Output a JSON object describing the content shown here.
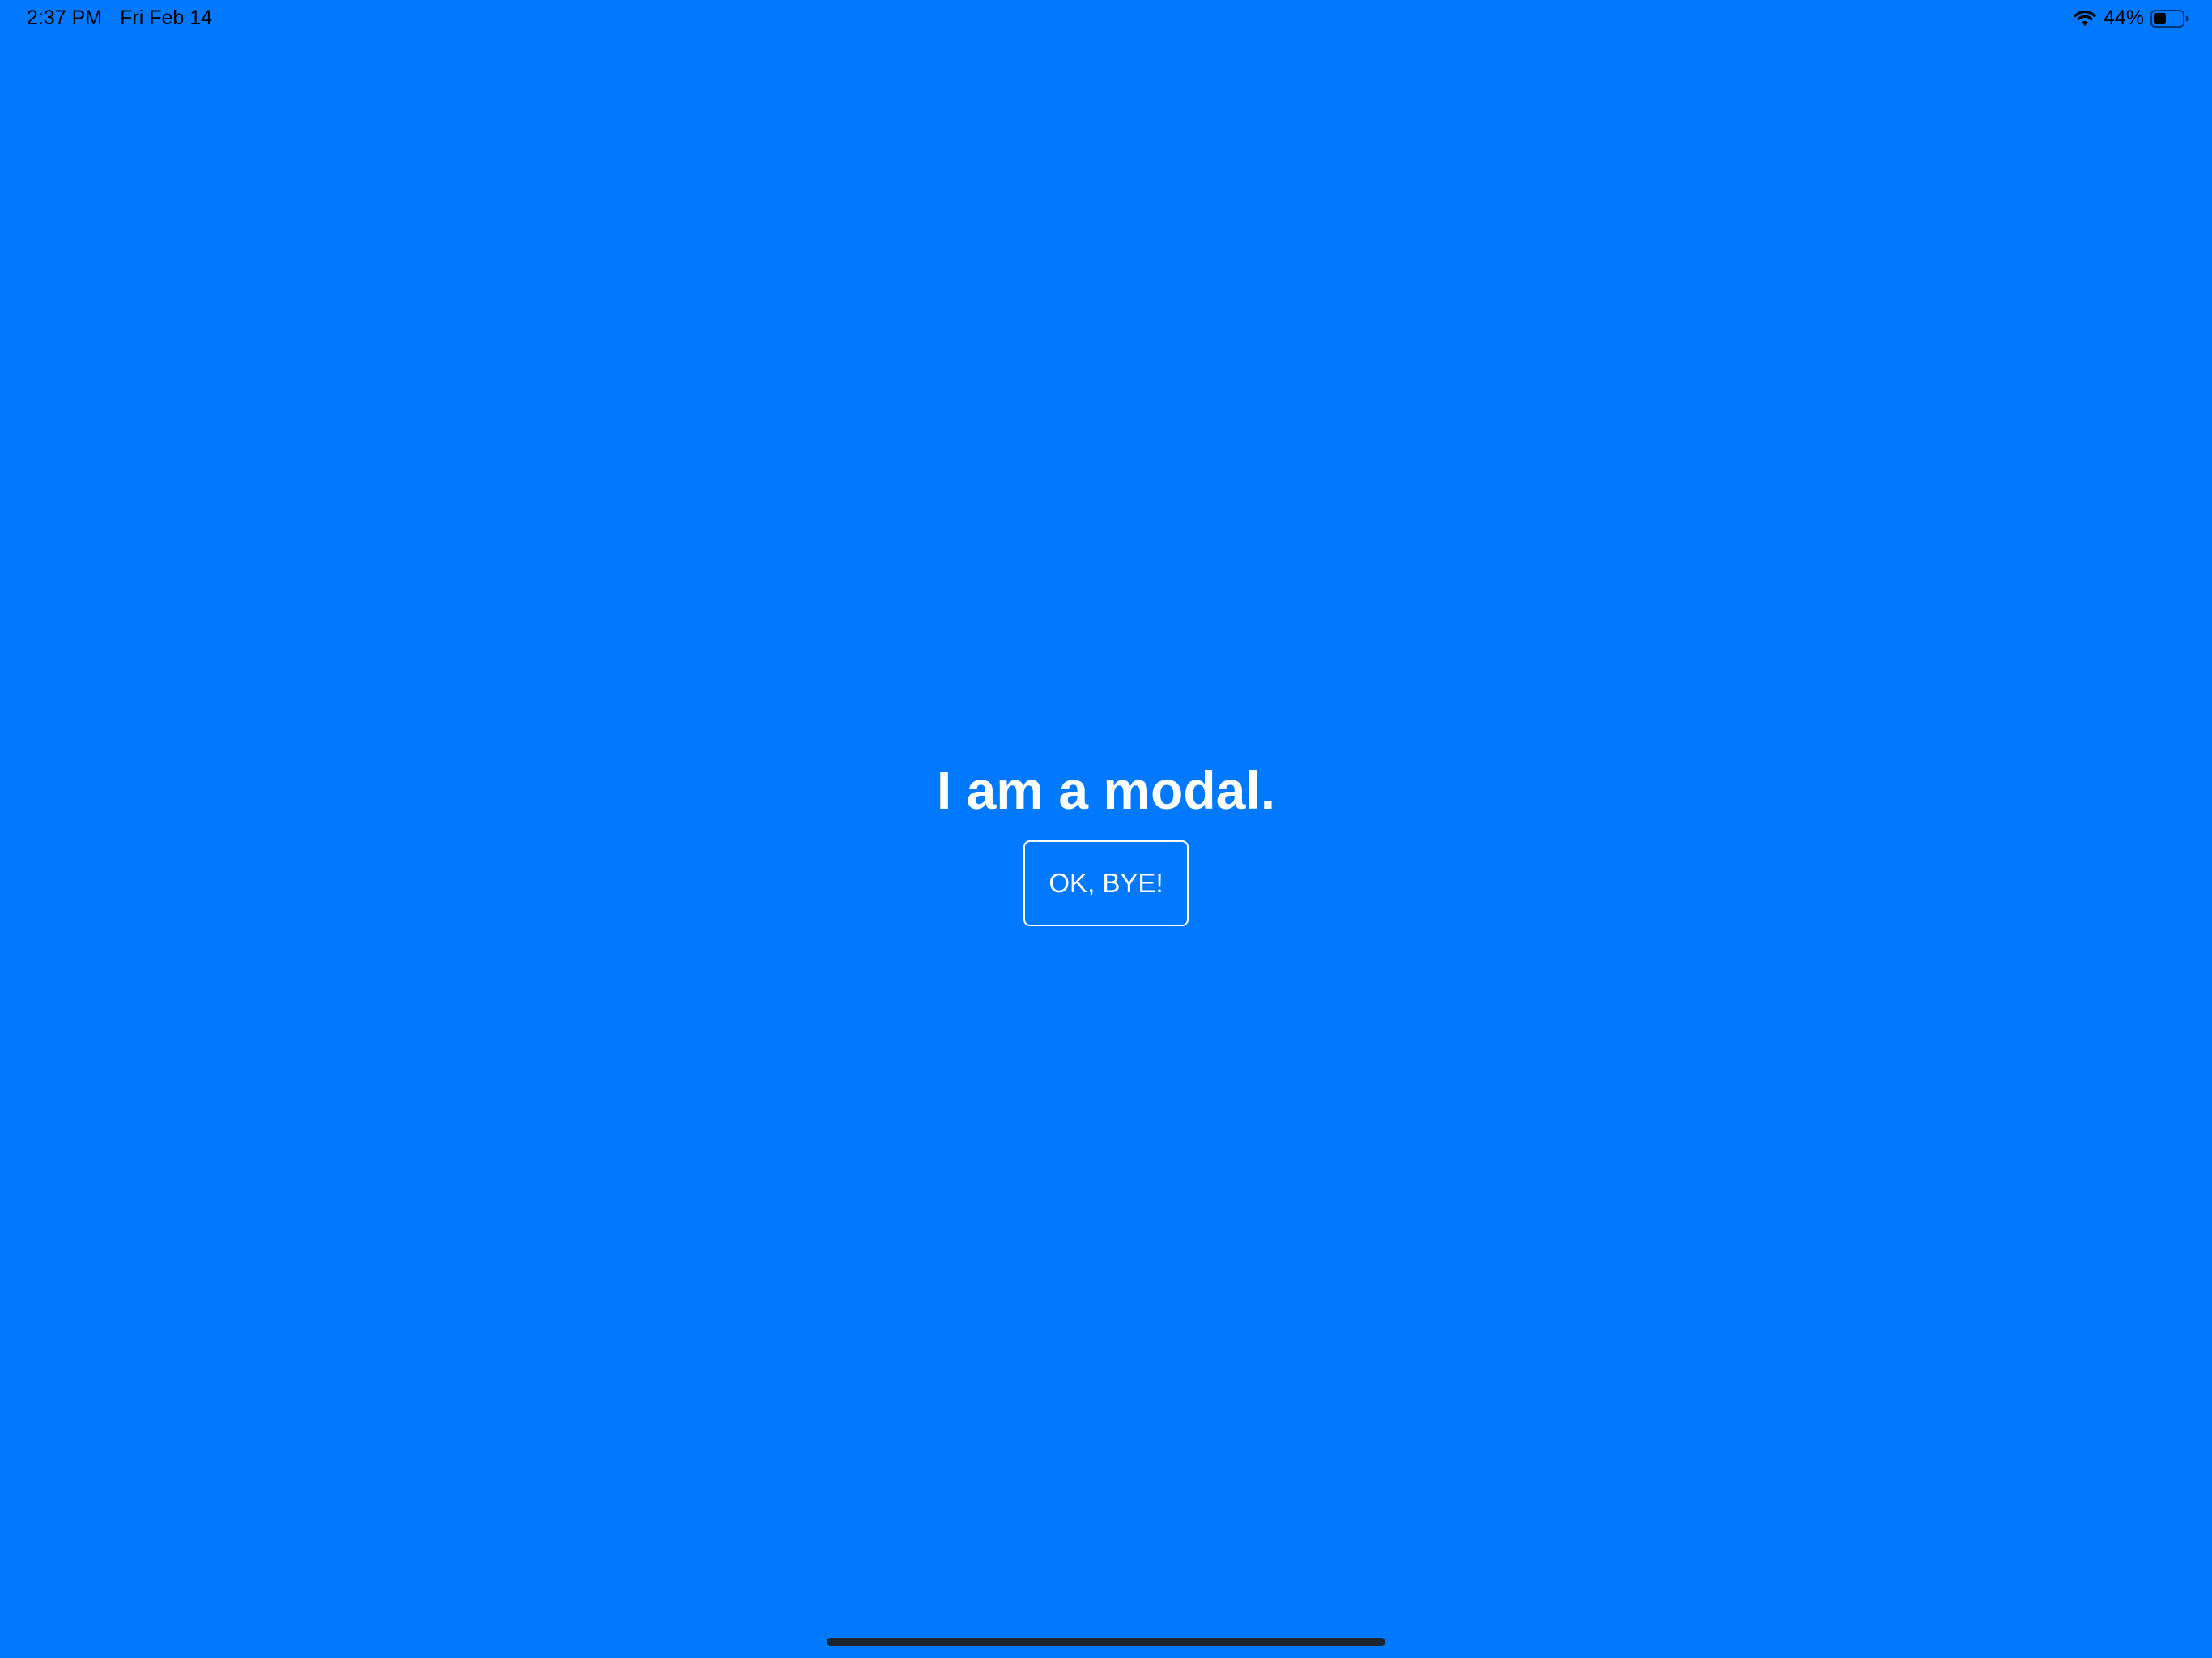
{
  "status_bar": {
    "time": "2:37 PM",
    "date": "Fri Feb 14",
    "battery_text": "44%",
    "battery_level": 0.44,
    "wifi_icon": "wifi-icon",
    "battery_icon": "battery-icon"
  },
  "modal": {
    "title": "I am a modal.",
    "button_label": "OK, BYE!"
  },
  "colors": {
    "background": "#0079FF",
    "text": "#FFFFFF",
    "home_indicator": "#1C2530"
  }
}
